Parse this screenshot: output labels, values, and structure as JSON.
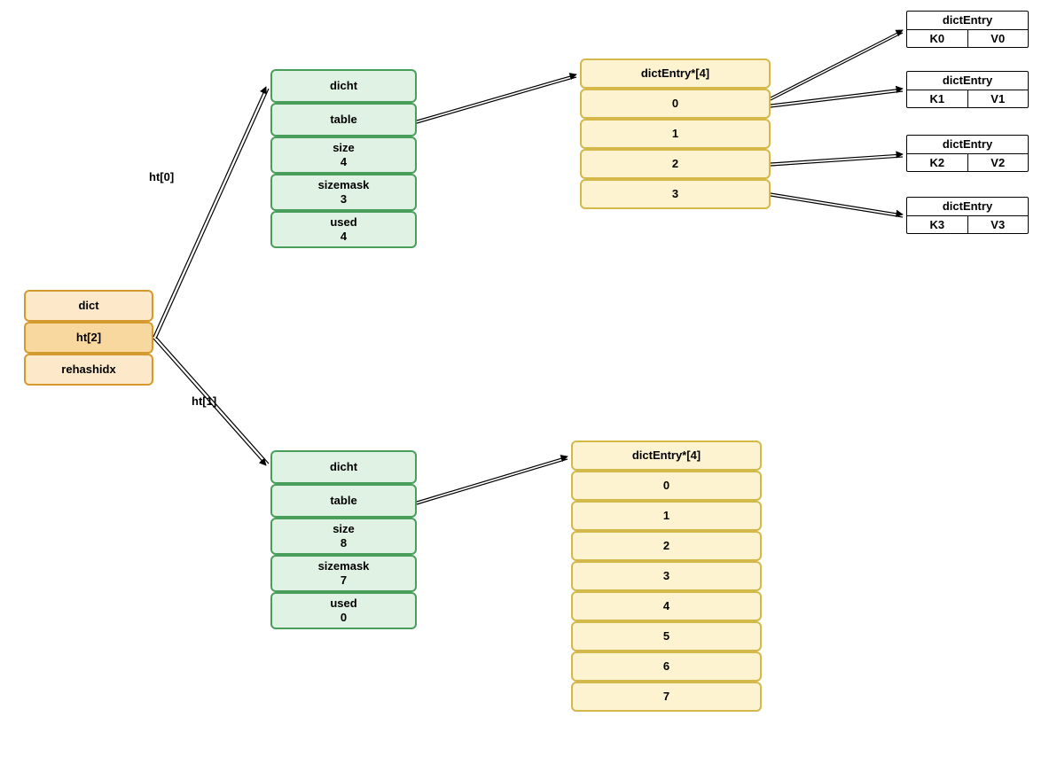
{
  "dict": {
    "title": "dict",
    "ht": "ht[2]",
    "rehashidx": "rehashidx"
  },
  "arrows": {
    "ht0": "ht[0]",
    "ht1": "ht[1]"
  },
  "dicht0": {
    "title": "dicht",
    "table": "table",
    "size_label": "size",
    "size_value": "4",
    "sizemask_label": "sizemask",
    "sizemask_value": "3",
    "used_label": "used",
    "used_value": "4"
  },
  "dicht1": {
    "title": "dicht",
    "table": "table",
    "size_label": "size",
    "size_value": "8",
    "sizemask_label": "sizemask",
    "sizemask_value": "7",
    "used_label": "used",
    "used_value": "0"
  },
  "arr0": {
    "title": "dictEntry*[4]",
    "slots": [
      "0",
      "1",
      "2",
      "3"
    ]
  },
  "arr1": {
    "title": "dictEntry*[4]",
    "slots": [
      "0",
      "1",
      "2",
      "3",
      "4",
      "5",
      "6",
      "7"
    ]
  },
  "entries": [
    {
      "title": "dictEntry",
      "k": "K0",
      "v": "V0"
    },
    {
      "title": "dictEntry",
      "k": "K1",
      "v": "V1"
    },
    {
      "title": "dictEntry",
      "k": "K2",
      "v": "V2"
    },
    {
      "title": "dictEntry",
      "k": "K3",
      "v": "V3"
    }
  ]
}
